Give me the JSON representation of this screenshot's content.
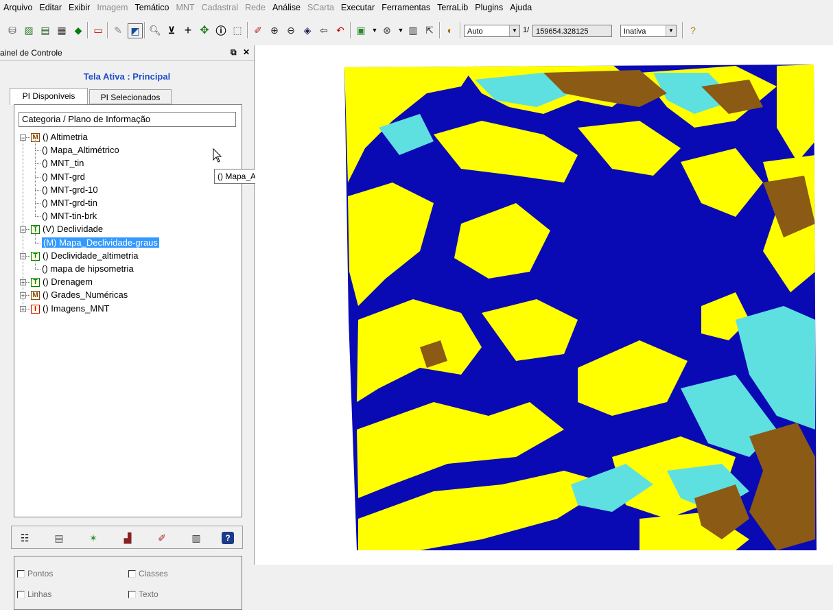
{
  "menu": [
    "Arquivo",
    "Editar",
    "Exibir",
    "Imagem",
    "Temático",
    "MNT",
    "Cadastral",
    "Rede",
    "Análise",
    "SCarta",
    "Executar",
    "Ferramentas",
    "TerraLib",
    "Plugins",
    "Ajuda"
  ],
  "menu_disabled": [
    "Imagem",
    "MNT",
    "Cadastral",
    "Rede",
    "SCarta"
  ],
  "toolbar": {
    "scale_mode": "Auto",
    "scale_prefix": "1/",
    "scale_value": "159654.328125",
    "layer_state": "Inativa"
  },
  "panel": {
    "title": "ainel de Controle",
    "active_screen": "Tela Ativa : Principal",
    "tabs": [
      "PI Disponíveis",
      "PI Selecionados"
    ],
    "tree_header": "Categoria / Plano de Informação",
    "tree": [
      {
        "label": "() Altimetria",
        "badge": "M",
        "level": 0,
        "expander": "−"
      },
      {
        "label": "() Mapa_Altimétrico",
        "level": 1
      },
      {
        "label": "() MNT_tin",
        "level": 1
      },
      {
        "label": "() MNT-grd",
        "level": 1
      },
      {
        "label": "() MNT-grd-10",
        "level": 1
      },
      {
        "label": "() MNT-grd-tin",
        "level": 1
      },
      {
        "label": "() MNT-tin-brk",
        "level": 1
      },
      {
        "label": "(V) Declividade",
        "badge": "T",
        "level": 0,
        "expander": "−"
      },
      {
        "label": "(M) Mapa_Declividade-graus",
        "level": 1,
        "selected": true
      },
      {
        "label": "() Declividade_altimetria",
        "badge": "T",
        "level": 0,
        "expander": "−"
      },
      {
        "label": "() mapa de hipsometria",
        "level": 1
      },
      {
        "label": "() Drenagem",
        "badge": "T",
        "level": 0,
        "expander": "+"
      },
      {
        "label": "() Grades_Numéricas",
        "badge": "M",
        "level": 0,
        "expander": "+"
      },
      {
        "label": "() Imagens_MNT",
        "badge": "I",
        "level": 0,
        "expander": "+"
      }
    ],
    "tooltip": "() Mapa_Altimétrico",
    "visibility": {
      "points": "Pontos",
      "classes": "Classes",
      "lines": "Linhas",
      "text": "Texto"
    }
  },
  "map_colors": {
    "water": "#0a0ab4",
    "yellow": "#ffff00",
    "cyan": "#5ee0e0",
    "brown": "#8b5a14",
    "background": "#ffffff"
  }
}
